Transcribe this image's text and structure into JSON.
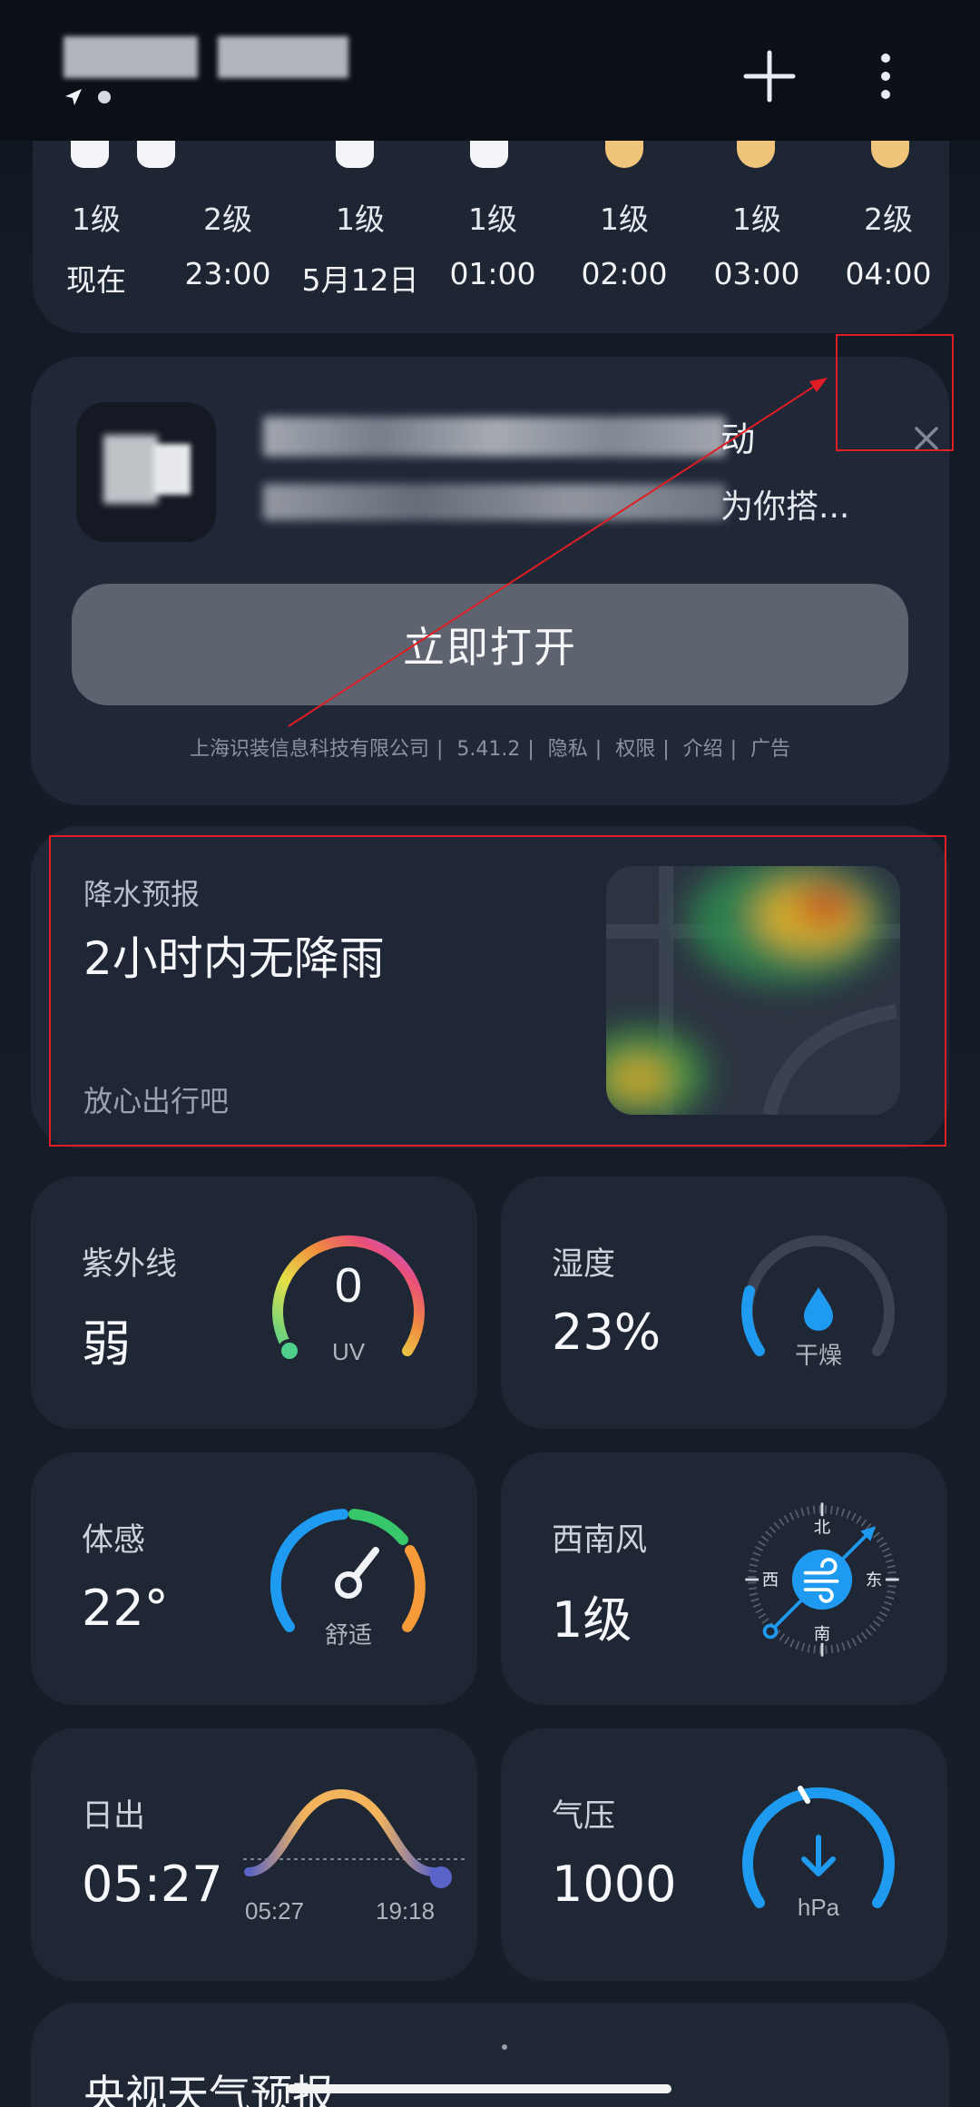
{
  "hourly": [
    {
      "level": "1级",
      "time": "现在",
      "icon": "cloud-night-icon"
    },
    {
      "level": "2级",
      "time": "23:00",
      "icon": "cloud-night-icon"
    },
    {
      "level": "1级",
      "time": "5月12日",
      "icon": "cloud-night-icon"
    },
    {
      "level": "1级",
      "time": "01:00",
      "icon": "cloud-night-icon"
    },
    {
      "level": "1级",
      "time": "02:00",
      "icon": "moon-icon"
    },
    {
      "level": "1级",
      "time": "03:00",
      "icon": "moon-icon"
    },
    {
      "level": "2级",
      "time": "04:00",
      "icon": "moon-icon"
    }
  ],
  "ad": {
    "title_tail": "动",
    "desc_tail": "为你搭...",
    "open_label": "立即打开",
    "footer": [
      "上海识装信息科技有限公司",
      "5.41.2",
      "隐私",
      "权限",
      "介绍",
      "广告"
    ]
  },
  "precipitation": {
    "label": "降水预报",
    "title": "2小时内无降雨",
    "subtitle": "放心出行吧"
  },
  "uv": {
    "label": "紫外线",
    "value": "弱",
    "reading": "0",
    "unit": "UV"
  },
  "humidity": {
    "label": "湿度",
    "value": "23%",
    "note": "干燥"
  },
  "feels": {
    "label": "体感",
    "value": "22°",
    "note": "舒适"
  },
  "wind": {
    "label": "西南风",
    "value": "1级",
    "north": "北",
    "south": "南",
    "west": "西",
    "east": "东"
  },
  "sunrise": {
    "label": "日出",
    "value": "05:27",
    "rise": "05:27",
    "set": "19:18"
  },
  "pressure": {
    "label": "气压",
    "value": "1000",
    "unit": "hPa"
  },
  "bottom": {
    "title": "央视天气预报"
  },
  "colors": {
    "accent": "#1e9bf0",
    "card": "#1f2735",
    "annotation": "#e01d25"
  }
}
